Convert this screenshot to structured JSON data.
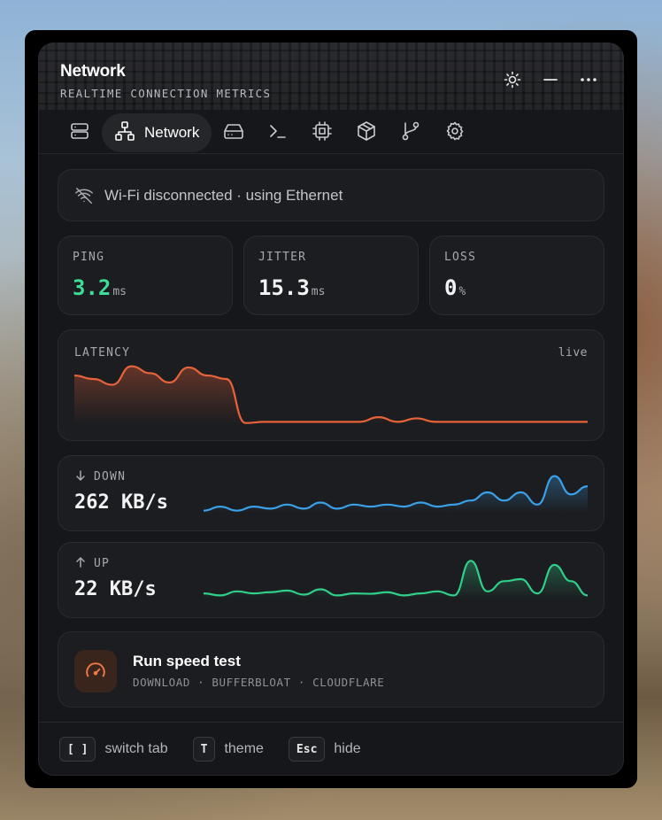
{
  "window": {
    "title": "Network",
    "subtitle": "REALTIME CONNECTION METRICS"
  },
  "header_controls": [
    "sun-icon",
    "minimize-icon",
    "more-icon"
  ],
  "tabs": [
    {
      "icon": "server-icon",
      "label": ""
    },
    {
      "icon": "network-icon",
      "label": "Network",
      "active": true
    },
    {
      "icon": "drive-icon",
      "label": ""
    },
    {
      "icon": "terminal-icon",
      "label": ""
    },
    {
      "icon": "cpu-icon",
      "label": ""
    },
    {
      "icon": "package-icon",
      "label": ""
    },
    {
      "icon": "git-branch-icon",
      "label": ""
    },
    {
      "icon": "settings-icon",
      "label": ""
    }
  ],
  "wifi": {
    "status": "Wi-Fi disconnected · using Ethernet"
  },
  "metrics": {
    "ping": {
      "label": "PING",
      "value": "3.2",
      "unit": "ms"
    },
    "jitter": {
      "label": "JITTER",
      "value": "15.3",
      "unit": "ms"
    },
    "loss": {
      "label": "LOSS",
      "value": "0",
      "unit": "%"
    }
  },
  "latency": {
    "label": "LATENCY",
    "badge": "live"
  },
  "down": {
    "label": "DOWN",
    "value": "262 KB/s"
  },
  "up": {
    "label": "UP",
    "value": "22 KB/s"
  },
  "speedtest": {
    "title": "Run speed test",
    "subtitle": "DOWNLOAD · BUFFERBLOAT · CLOUDFLARE"
  },
  "footer": {
    "switch_key": "[ ]",
    "switch_label": "switch tab",
    "theme_key": "T",
    "theme_label": "theme",
    "hide_key": "Esc",
    "hide_label": "hide"
  },
  "colors": {
    "accent_green": "#3ddc97",
    "latency_line": "#e8623a",
    "down_line": "#3aa0e8",
    "up_line": "#2fcf8a",
    "speedtest_icon": "#f07a45"
  },
  "chart_data": [
    {
      "type": "area",
      "title": "LATENCY",
      "values": [
        2.1,
        1.95,
        1.7,
        2.5,
        2.2,
        1.8,
        2.45,
        2.1,
        1.95,
        0.05,
        0.1,
        0.1,
        0.1,
        0.1,
        0.1,
        0.1,
        0.3,
        0.1,
        0.25,
        0.1,
        0.1,
        0.1,
        0.1,
        0.1,
        0.1,
        0.1,
        0.1,
        0.1
      ]
    },
    {
      "type": "area",
      "title": "DOWN",
      "values": [
        0.05,
        0.15,
        0.05,
        0.15,
        0.1,
        0.2,
        0.1,
        0.25,
        0.1,
        0.2,
        0.15,
        0.2,
        0.15,
        0.25,
        0.15,
        0.2,
        0.3,
        0.5,
        0.3,
        0.5,
        0.2,
        0.9,
        0.45,
        0.65
      ]
    },
    {
      "type": "area",
      "title": "UP",
      "values": [
        0.15,
        0.1,
        0.2,
        0.15,
        0.18,
        0.22,
        0.12,
        0.25,
        0.1,
        0.15,
        0.14,
        0.18,
        0.1,
        0.15,
        0.2,
        0.1,
        0.95,
        0.2,
        0.45,
        0.5,
        0.15,
        0.85,
        0.45,
        0.1
      ]
    }
  ]
}
